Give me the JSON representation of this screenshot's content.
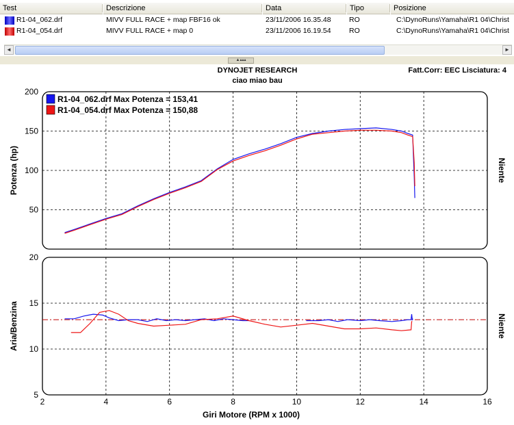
{
  "table": {
    "headers": [
      "Test",
      "Descrizione",
      "Data",
      "Tipo",
      "Posizione"
    ],
    "rows": [
      {
        "name": "R1-04_062.drf",
        "desc": "MIVV FULL RACE + map FBF16 ok",
        "date": "23/11/2006 16.35.48",
        "type": "RO",
        "path": "C:\\DynoRuns\\Yamaha\\R1 04\\Christ",
        "color": "#1515ee"
      },
      {
        "name": "R1-04_054.drf",
        "desc": "MIVV FULL RACE + map 0",
        "date": "23/11/2006 16.19.54",
        "type": "RO",
        "path": "C:\\DynoRuns\\Yamaha\\R1 04\\Christ",
        "color": "#ee1515"
      }
    ]
  },
  "splitter_glyph": "▲▴▴▴",
  "scroll": {
    "left": "◄",
    "right": "►"
  },
  "chart_header": {
    "title": "DYNOJET RESEARCH",
    "subtitle": "ciao miao bau",
    "corr": "Fatt.Corr: EEC  Lisciatura: 4"
  },
  "colors": {
    "run1": "#1515ee",
    "run2": "#ee1515",
    "grid": "#000000",
    "ref": "#c00000"
  },
  "chart_data": [
    {
      "type": "line",
      "ylabel": "Potenza (hp)",
      "right_label": "Niente",
      "xlim": [
        2,
        16
      ],
      "ylim": [
        0,
        200
      ],
      "yticks": [
        50,
        100,
        150,
        200
      ],
      "legend": "top-left",
      "grid": true,
      "series": [
        {
          "name": "R1-04_062.drf Max Potenza = 153,41",
          "x": [
            2.7,
            3.0,
            3.5,
            4.0,
            4.5,
            5.0,
            5.5,
            6.0,
            6.5,
            7.0,
            7.5,
            8.0,
            8.5,
            9.0,
            9.5,
            10.0,
            10.5,
            11.0,
            11.5,
            12.0,
            12.5,
            13.0,
            13.3,
            13.5,
            13.65,
            13.7,
            13.72
          ],
          "y": [
            21,
            25,
            32,
            39,
            45,
            55,
            64,
            72,
            79,
            87,
            102,
            114,
            121,
            127,
            134,
            142,
            147,
            150,
            152,
            153,
            154,
            152,
            150,
            147,
            145,
            92,
            65
          ]
        },
        {
          "name": "R1-04_054.drf Max Potenza = 150,88",
          "x": [
            2.7,
            3.0,
            3.5,
            4.0,
            4.5,
            5.0,
            5.5,
            6.0,
            6.5,
            7.0,
            7.5,
            8.0,
            8.5,
            9.0,
            9.5,
            10.0,
            10.5,
            11.0,
            11.5,
            12.0,
            12.5,
            13.0,
            13.3,
            13.5,
            13.65,
            13.7,
            13.72
          ],
          "y": [
            20,
            24,
            31,
            38,
            44,
            54,
            63,
            71,
            78,
            86,
            101,
            112,
            119,
            125,
            132,
            140,
            146,
            148,
            150,
            151,
            151,
            150,
            148,
            145,
            143,
            110,
            80
          ]
        }
      ]
    },
    {
      "type": "line",
      "ylabel": "Aria/Benzina",
      "right_label": "Niente",
      "xlabel": "Giri Motore (RPM x 1000)",
      "xlim": [
        2,
        16
      ],
      "xticks": [
        2,
        4,
        6,
        8,
        10,
        12,
        14,
        16
      ],
      "ylim": [
        5,
        20
      ],
      "yticks": [
        5,
        10,
        15,
        20
      ],
      "reference_line": 13.2,
      "grid": true,
      "series": [
        {
          "name": "R1-04_062.drf",
          "x": [
            2.7,
            3.0,
            3.3,
            3.6,
            3.9,
            4.1,
            4.4,
            4.7,
            5.0,
            5.3,
            5.6,
            5.9,
            6.2,
            6.5,
            6.8,
            7.1,
            7.4,
            7.7,
            8.0,
            8.3,
            8.5
          ],
          "y": [
            13.3,
            13.3,
            13.6,
            13.8,
            13.7,
            13.4,
            13.1,
            13.2,
            13.2,
            13.0,
            13.3,
            13.1,
            13.2,
            13.1,
            13.2,
            13.3,
            13.1,
            13.3,
            13.2,
            13.1,
            13.1
          ],
          "x2": [
            10.3,
            10.7,
            11.0,
            11.3,
            11.6,
            12.0,
            12.3,
            12.6,
            13.0,
            13.3,
            13.5,
            13.6,
            13.62,
            13.64,
            13.66
          ],
          "y2": [
            13.1,
            13.1,
            13.2,
            13.0,
            13.2,
            13.1,
            13.2,
            13.1,
            13.0,
            13.1,
            13.2,
            13.2,
            13.8,
            13.2,
            13.3
          ]
        },
        {
          "name": "R1-04_054.drf",
          "x": [
            2.9,
            3.2,
            3.5,
            3.8,
            4.1,
            4.4,
            4.7,
            5.0,
            5.5,
            6.0,
            6.5,
            7.0,
            7.5,
            8.0,
            8.5,
            9.0,
            9.5,
            10.0,
            10.5,
            11.0,
            11.5,
            12.0,
            12.5,
            13.0,
            13.3,
            13.6,
            13.62,
            13.64
          ],
          "y": [
            11.8,
            11.8,
            12.8,
            14.0,
            14.2,
            13.8,
            13.1,
            12.8,
            12.5,
            12.6,
            12.7,
            13.2,
            13.3,
            13.6,
            13.1,
            12.7,
            12.4,
            12.6,
            12.8,
            12.5,
            12.2,
            12.2,
            12.3,
            12.1,
            12.0,
            12.1,
            13.0,
            13.0
          ]
        }
      ]
    }
  ]
}
